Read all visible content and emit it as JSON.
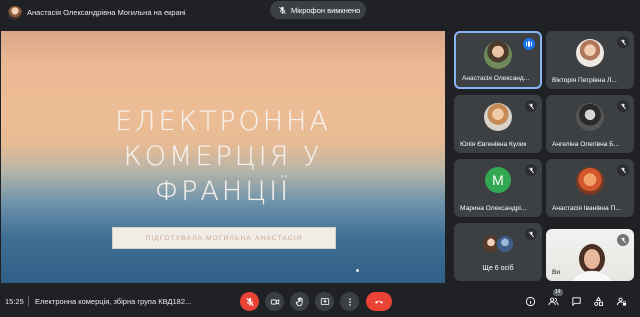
{
  "topbar": {
    "presenter_label": "Анастасія Олександрівна Могильна на екрані",
    "mic_toast": "Мікрофон вимкнено"
  },
  "slide": {
    "title_line1": "ЕЛЕКТРОННА",
    "title_line2": "КОМЕРЦІЯ У",
    "title_line3": "ФРАНЦІЇ",
    "author": "ПІДГОТУВАЛА МОГИЛЬНА АНАСТАСІЯ"
  },
  "participants": [
    {
      "name": "Анастасія Олександ...",
      "state": "speaking"
    },
    {
      "name": "Вікторія Петрівна Л...",
      "state": "muted"
    },
    {
      "name": "Юлія Євгенівна Кулик",
      "state": "muted"
    },
    {
      "name": "Ангеліна Олегівна Б...",
      "state": "muted"
    },
    {
      "name": "Марина Олександрі...",
      "state": "muted",
      "initial": "M"
    },
    {
      "name": "Анастасія Іванівна П...",
      "state": "muted"
    },
    {
      "name": "Ще 6 осіб",
      "state": "muted"
    },
    {
      "name": "Ви",
      "state": "muted"
    }
  ],
  "bottombar": {
    "time": "15:25",
    "meeting_title": "Електронна комерція, збірна група КВД182...",
    "participant_count": "14"
  },
  "colors": {
    "accent": "#8ab4f8",
    "danger": "#ea4335",
    "tile_bg": "#3c4043",
    "background": "#202124"
  }
}
